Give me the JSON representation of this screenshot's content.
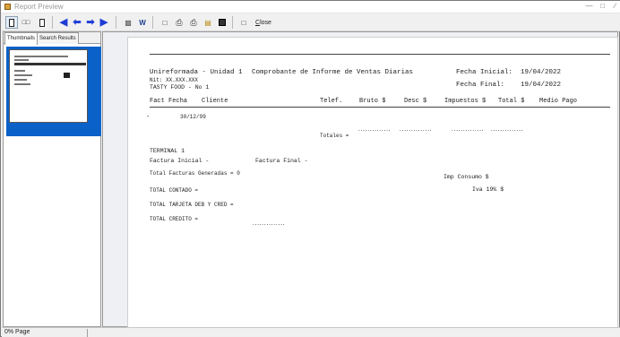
{
  "window": {
    "title": "Report Preview"
  },
  "toolbar": {
    "close_prefix": "C",
    "close_rest": "lose"
  },
  "leftpane": {
    "tabs": [
      "Thumbnails",
      "Search Results"
    ]
  },
  "report": {
    "company": "Unireformada - Unidad 1",
    "doc_title": "Comprobante de Informe de Ventas Diarias",
    "nit": "Nit: XX.XXX.XXX",
    "store": "TASTY FOOD - No 1",
    "fecha_inicial_label": "Fecha Inicial:",
    "fecha_inicial": "19/04/2022",
    "fecha_final_label": "Fecha Final:",
    "fecha_final": "19/04/2022",
    "columns": [
      "Fact",
      "Fecha",
      "Cliente",
      "Telef.",
      "Bruto $",
      "Desc $",
      "Impuestos $",
      "Total $",
      "Medio Pago"
    ],
    "row": {
      "dash": "-",
      "fecha": "30/12/99"
    },
    "totales_label": "Totales =",
    "terminal": "TERMINAL 1",
    "factura_inicial": "Factura Inicial -",
    "factura_final": "Factura Final -",
    "total_facturas": "Total Facturas Generadas = 0",
    "imp_consumo": "Imp Consumo $",
    "iva": "Iva 19% $",
    "total_contado": "TOTAL CONTADO =",
    "total_tarjeta": "TOTAL TARJETA DEB Y CRED =",
    "total_credito": "TOTAL CREDITO ="
  },
  "status": {
    "page_text": "0% Page"
  }
}
